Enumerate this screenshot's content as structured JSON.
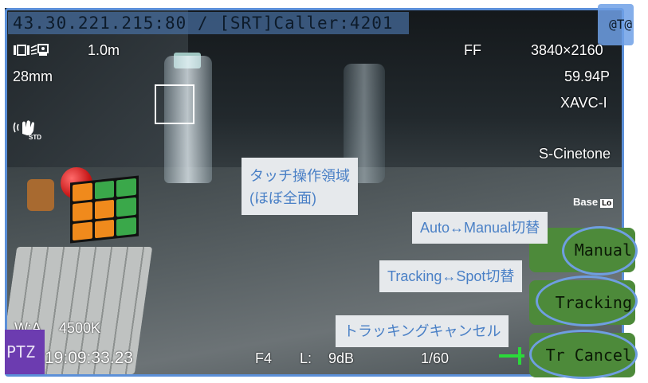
{
  "stream": {
    "address": "43.30.221.215:80 / [SRT]Caller:4201"
  },
  "top_right_button": {
    "label": "@T@"
  },
  "osd": {
    "focus_distance": "1.0m",
    "focal_length": "28mm",
    "focus_mode": "FF",
    "resolution": "3840×2160",
    "frame_rate": "59.94P",
    "codec": "XAVC-I",
    "picture_profile": "S-Cinetone",
    "base_iso": "Base",
    "base_iso_badge": "Lo",
    "white_balance_label": "W:A",
    "white_balance_value": "4500K",
    "timecode": "19:09:33.23",
    "iris": "F4",
    "gain_label": "L:",
    "gain_value": "9dB",
    "shutter": "1/60"
  },
  "ptz_button": {
    "label": "PTZ"
  },
  "buttons": {
    "manual": "Manual",
    "tracking": "Tracking",
    "tr_cancel": "Tr Cancel"
  },
  "annotations": {
    "touch_area_line1": "タッチ操作領域",
    "touch_area_line2": "(ほぼ全面)",
    "auto_manual": "Auto↔Manual切替",
    "tracking_spot": "Tracking↔Spot切替",
    "tracking_cancel": "トラッキングキャンセル"
  },
  "icons": {
    "focus_assist": "focus-assist-icon",
    "steady_shot": "steady-shot-icon"
  },
  "colors": {
    "overlay_blue": "#5b8fd8",
    "button_green": "#4d8a3a",
    "ptz_purple": "#6c3cb0",
    "annotation_text": "#4a80c6",
    "focus_green": "#2bd93a"
  }
}
